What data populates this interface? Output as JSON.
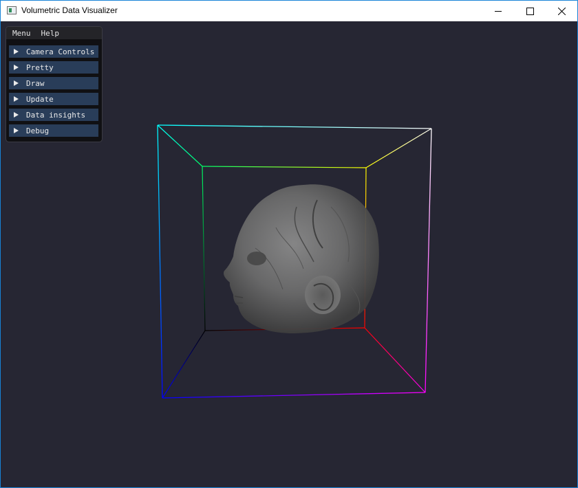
{
  "window": {
    "title": "Volumetric Data Visualizer",
    "controls": {
      "minimize": "minimize",
      "maximize": "maximize",
      "close": "close"
    }
  },
  "menu": {
    "items": [
      "Menu",
      "Help"
    ]
  },
  "panel": {
    "sections": [
      {
        "label": "Camera Controls"
      },
      {
        "label": "Pretty"
      },
      {
        "label": "Draw"
      },
      {
        "label": "Update"
      },
      {
        "label": "Data insights"
      },
      {
        "label": "Debug"
      }
    ]
  },
  "colors": {
    "background": "#262633",
    "panel_bg": "#101013",
    "item_bg": "#293d59",
    "title_bar": "#ffffff"
  },
  "scene": {
    "subject": "volume-rendered head",
    "bounding_box": "rgb color cube"
  }
}
